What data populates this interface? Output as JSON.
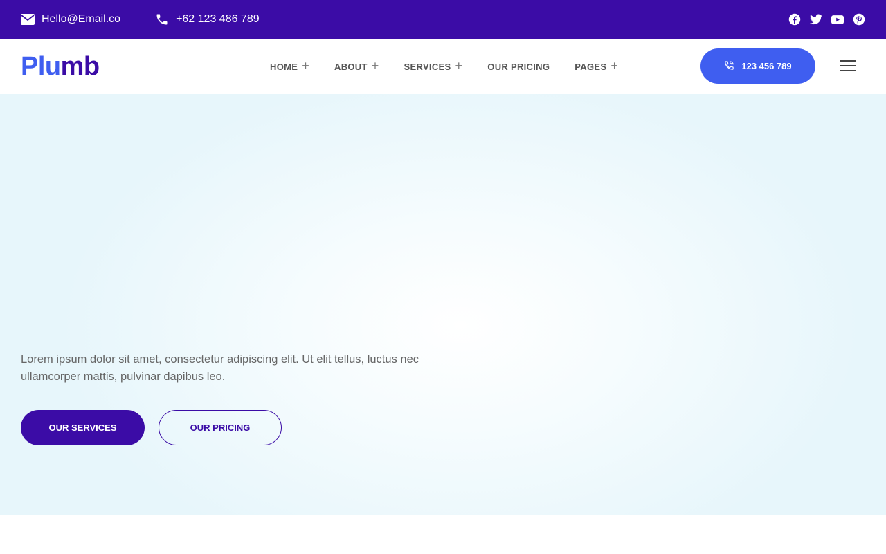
{
  "colors": {
    "primary": "#3b0ca6",
    "accent": "#3f5ef0",
    "hero_bg": "#e7f6fb"
  },
  "topbar": {
    "email": {
      "icon": "envelope-icon",
      "text": "Hello@Email.co"
    },
    "phone": {
      "icon": "phone-icon",
      "text": "+62 123 486 789"
    },
    "social": [
      "facebook-icon",
      "twitter-icon",
      "youtube-icon",
      "pinterest-icon"
    ]
  },
  "header": {
    "logo_part1": "Plu",
    "logo_part2": "mb",
    "nav": [
      {
        "label": "HOME",
        "has_submenu": true
      },
      {
        "label": "ABOUT",
        "has_submenu": true
      },
      {
        "label": "SERVICES",
        "has_submenu": true
      },
      {
        "label": "OUR PRICING",
        "has_submenu": false
      },
      {
        "label": "PAGES",
        "has_submenu": true
      }
    ],
    "submenu_glyph": "+",
    "call_button": "123 456 789"
  },
  "hero": {
    "text": "Lorem ipsum dolor sit amet, consectetur adipiscing elit. Ut elit tellus, luctus nec ullamcorper mattis, pulvinar dapibus leo.",
    "primary_button": "OUR SERVICES",
    "secondary_button": "OUR PRICING"
  }
}
